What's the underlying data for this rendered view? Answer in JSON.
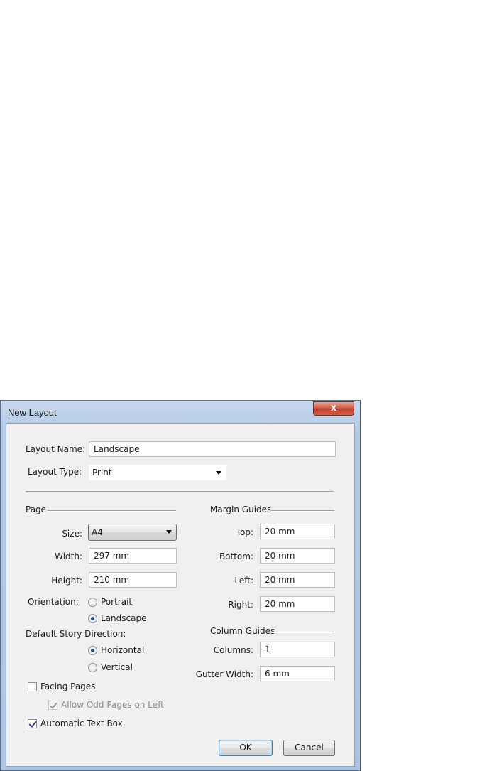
{
  "window": {
    "title": "New Layout",
    "close_glyph": "x"
  },
  "layout": {
    "name_label": "Layout Name:",
    "name_value": "Landscape",
    "type_label": "Layout Type:",
    "type_value": "Print"
  },
  "page": {
    "section_label": "Page",
    "size_label": "Size:",
    "size_value": "A4",
    "width_label": "Width:",
    "width_value": "297 mm",
    "height_label": "Height:",
    "height_value": "210 mm",
    "orientation_label": "Orientation:",
    "orientation_options": [
      "Portrait",
      "Landscape"
    ],
    "orientation_selected": "Landscape",
    "story_direction_label": "Default Story Direction:",
    "story_options": [
      "Horizontal",
      "Vertical"
    ],
    "story_selected": "Horizontal"
  },
  "margins": {
    "section_label": "Margin Guides",
    "top_label": "Top:",
    "top_value": "20 mm",
    "bottom_label": "Bottom:",
    "bottom_value": "20 mm",
    "left_label": "Left:",
    "left_value": "20 mm",
    "right_label": "Right:",
    "right_value": "20 mm"
  },
  "columns": {
    "section_label": "Column Guides",
    "columns_label": "Columns:",
    "columns_value": "1",
    "gutter_label": "Gutter Width:",
    "gutter_value": "6 mm"
  },
  "options": {
    "facing_pages_label": "Facing Pages",
    "facing_pages_checked": false,
    "odd_pages_label": "Allow Odd Pages on Left",
    "odd_pages_checked": true,
    "odd_pages_enabled": false,
    "auto_text_box_label": "Automatic Text Box",
    "auto_text_box_checked": true
  },
  "buttons": {
    "ok": "OK",
    "cancel": "Cancel"
  }
}
